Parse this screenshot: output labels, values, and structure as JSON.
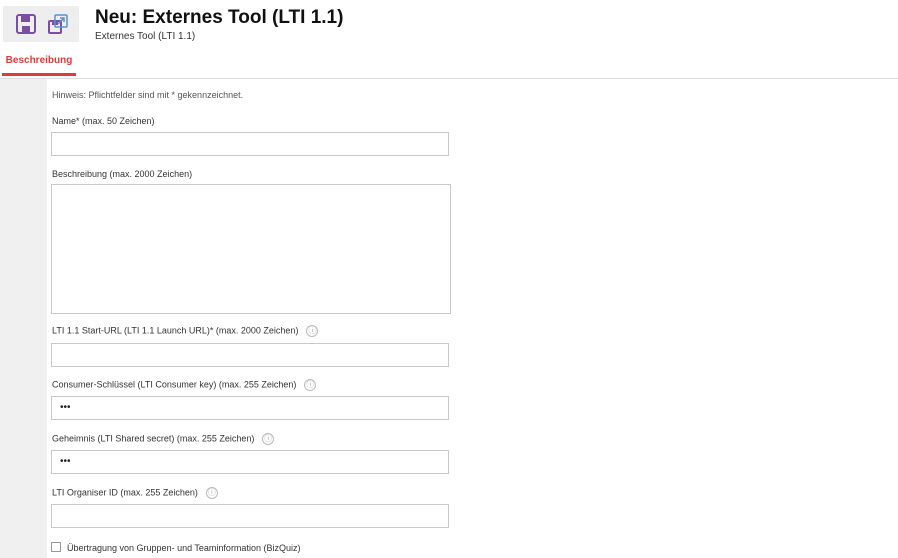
{
  "toolbar": {
    "save_icon": "save-icon",
    "save_close_icon": "save-and-close-icon"
  },
  "header": {
    "title": "Neu: Externes Tool (LTI 1.1)",
    "subtitle": "Externes Tool (LTI 1.1)"
  },
  "tabs": [
    {
      "label": "Beschreibung",
      "active": true
    }
  ],
  "accent_color": "#e03a3a",
  "form": {
    "hint": "Hinweis: Pflichtfelder sind mit * gekennzeichnet.",
    "name": {
      "label": "Name* (max. 50 Zeichen)",
      "value": ""
    },
    "description": {
      "label": "Beschreibung (max. 2000 Zeichen)",
      "value": ""
    },
    "start_url": {
      "label": "LTI 1.1 Start-URL (LTI 1.1 Launch URL)* (max. 2000 Zeichen)",
      "value": "",
      "info": "ⓘ"
    },
    "consumer_key": {
      "label": "Consumer-Schlüssel (LTI Consumer key) (max. 255 Zeichen)",
      "value": "•••",
      "info": "ⓘ"
    },
    "shared_secret": {
      "label": "Geheimnis (LTI Shared secret) (max. 255 Zeichen)",
      "value": "•••",
      "info": "ⓘ"
    },
    "organiser_id": {
      "label": "LTI Organiser ID (max. 255 Zeichen)",
      "value": "",
      "info": "ⓘ"
    },
    "transfer_checkbox": {
      "label": "Übertragung von Gruppen- und Teaminformation (BizQuiz)",
      "checked": false
    }
  }
}
